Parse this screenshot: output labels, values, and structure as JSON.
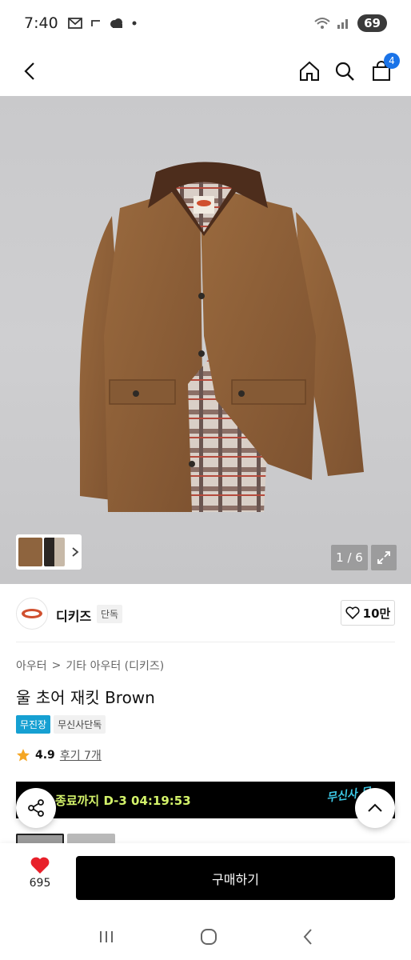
{
  "status": {
    "time": "7:40",
    "battery": "69"
  },
  "header": {
    "cart_count": "4"
  },
  "gallery": {
    "pager": "1 / 6"
  },
  "brand": {
    "name": "디키즈",
    "tag": "단독",
    "likes": "10만"
  },
  "breadcrumb": {
    "level1": "아우터",
    "separator": ">",
    "level2": "기타 아우터 (디키즈)"
  },
  "product": {
    "title": "울 초어 재킷 Brown",
    "badge_free_shipping": "무진장",
    "badge_exclusive": "무신사단독",
    "rating": "4.9",
    "review_label": "후기 7개"
  },
  "promo": {
    "text": "장 종료까지 D-3 04:19:53",
    "brand_mark": "무신사 무"
  },
  "bottom": {
    "wish_count": "695",
    "buy_label": "구매하기"
  },
  "colors": {
    "accent_blue": "#1a73e8",
    "badge_blue": "#16a0d2",
    "promo_green": "#d3f26a",
    "heart_red": "#e8202a"
  }
}
